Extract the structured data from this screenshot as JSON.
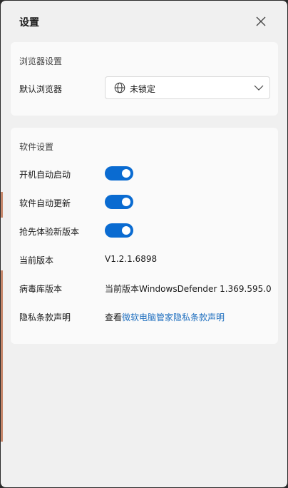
{
  "window": {
    "title": "设置"
  },
  "browser_settings": {
    "section_title": "浏览器设置",
    "default_browser_label": "默认浏览器",
    "default_browser_value": "未锁定"
  },
  "software_settings": {
    "section_title": "软件设置",
    "autostart_label": "开机自动启动",
    "autostart_on": true,
    "autoupdate_label": "软件自动更新",
    "autoupdate_on": true,
    "preview_label": "抢先体验新版本",
    "preview_on": true,
    "version_label": "当前版本",
    "version_value": "V1.2.1.6898",
    "virus_db_label": "病毒库版本",
    "virus_db_value": "当前版本WindowsDefender 1.369.595.0",
    "privacy_label": "隐私条款声明",
    "privacy_prefix": "查看",
    "privacy_link": "微软电脑管家隐私条款声明"
  },
  "colors": {
    "accent": "#0a6bd1",
    "link": "#1f6fbf",
    "panel_bg": "#f0f0f0",
    "card_bg": "#fafafa"
  },
  "icons": {
    "close": "close-icon",
    "globe": "globe-icon",
    "dropdown": "chevron-down-icon"
  }
}
